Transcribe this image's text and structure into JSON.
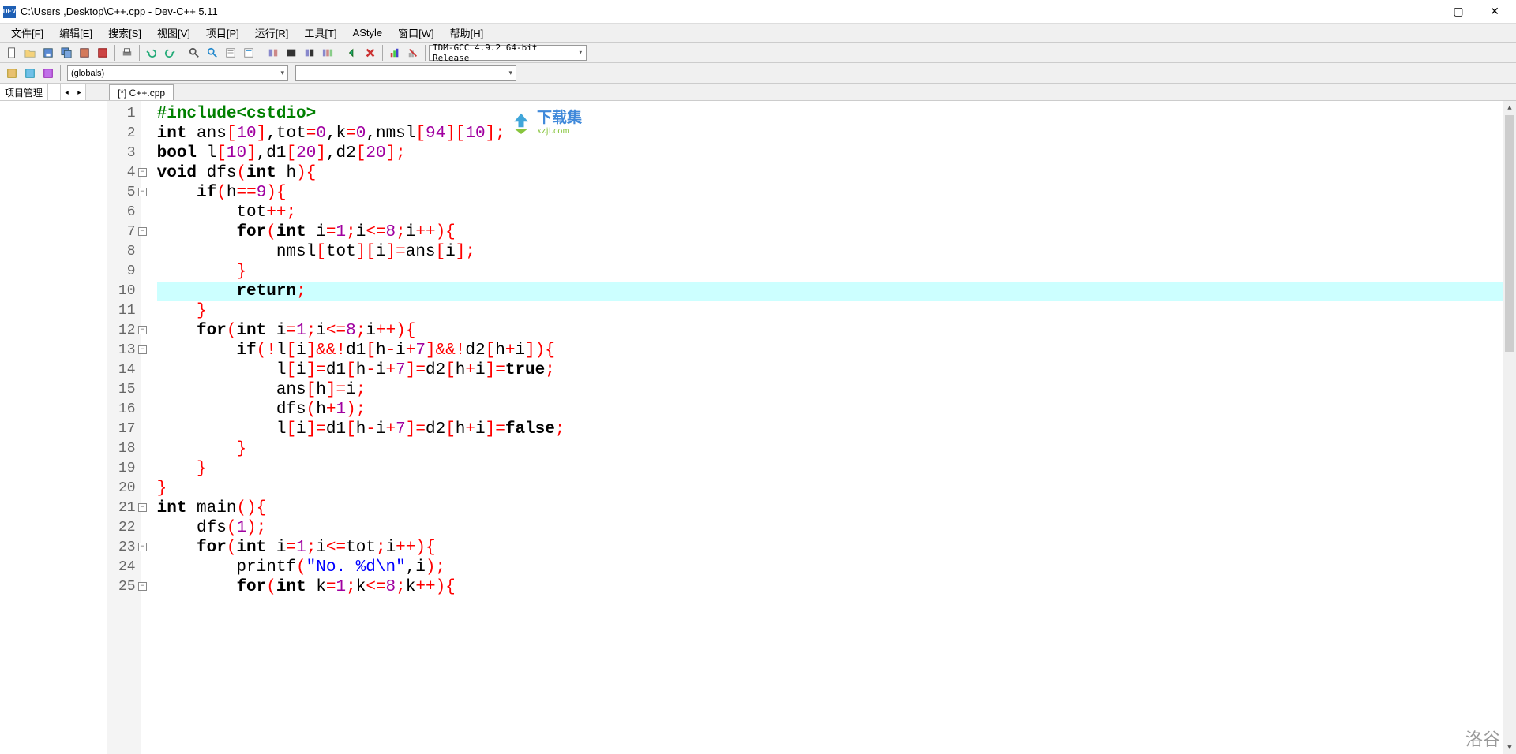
{
  "titlebar": {
    "app_icon_text": "DEV",
    "title": "C:\\Users          ,Desktop\\C++.cpp - Dev-C++ 5.11"
  },
  "menus": [
    "文件[F]",
    "编辑[E]",
    "搜索[S]",
    "视图[V]",
    "项目[P]",
    "运行[R]",
    "工具[T]",
    "AStyle",
    "窗口[W]",
    "帮助[H]"
  ],
  "compiler_combo": "TDM-GCC 4.9.2 64-bit Release",
  "globals_combo": "(globals)",
  "sidebar": {
    "tab_label": "项目管理"
  },
  "file_tab": "[*] C++.cpp",
  "watermark": {
    "cn": "下载集",
    "url": "xzji.com"
  },
  "corner": "洛谷",
  "code": [
    {
      "n": 1,
      "fold": "",
      "tokens": [
        [
          "pp",
          "#include"
        ],
        [
          "pp",
          "<cstdio>"
        ]
      ]
    },
    {
      "n": 2,
      "fold": "",
      "tokens": [
        [
          "k",
          "int "
        ],
        [
          "n",
          "ans"
        ],
        [
          "br",
          "["
        ],
        [
          "num",
          "10"
        ],
        [
          "br",
          "]"
        ],
        [
          "n",
          ",tot"
        ],
        [
          "br",
          "="
        ],
        [
          "num",
          "0"
        ],
        [
          "n",
          ",k"
        ],
        [
          "br",
          "="
        ],
        [
          "num",
          "0"
        ],
        [
          "n",
          ",nmsl"
        ],
        [
          "br",
          "["
        ],
        [
          "num",
          "94"
        ],
        [
          "br",
          "]["
        ],
        [
          "num",
          "10"
        ],
        [
          "br",
          "];"
        ]
      ]
    },
    {
      "n": 3,
      "fold": "",
      "tokens": [
        [
          "k",
          "bool "
        ],
        [
          "n",
          "l"
        ],
        [
          "br",
          "["
        ],
        [
          "num",
          "10"
        ],
        [
          "br",
          "]"
        ],
        [
          "n",
          ",d1"
        ],
        [
          "br",
          "["
        ],
        [
          "num",
          "20"
        ],
        [
          "br",
          "]"
        ],
        [
          "n",
          ",d2"
        ],
        [
          "br",
          "["
        ],
        [
          "num",
          "20"
        ],
        [
          "br",
          "];"
        ]
      ]
    },
    {
      "n": 4,
      "fold": "m",
      "tokens": [
        [
          "k",
          "void "
        ],
        [
          "n",
          "dfs"
        ],
        [
          "br",
          "("
        ],
        [
          "k",
          "int "
        ],
        [
          "n",
          "h"
        ],
        [
          "br",
          "){"
        ]
      ]
    },
    {
      "n": 5,
      "fold": "m",
      "tokens": [
        [
          "n",
          "    "
        ],
        [
          "k",
          "if"
        ],
        [
          "br",
          "("
        ],
        [
          "n",
          "h"
        ],
        [
          "br",
          "=="
        ],
        [
          "num",
          "9"
        ],
        [
          "br",
          "){"
        ]
      ]
    },
    {
      "n": 6,
      "fold": "",
      "tokens": [
        [
          "n",
          "        tot"
        ],
        [
          "br",
          "++;"
        ]
      ]
    },
    {
      "n": 7,
      "fold": "m",
      "tokens": [
        [
          "n",
          "        "
        ],
        [
          "k",
          "for"
        ],
        [
          "br",
          "("
        ],
        [
          "k",
          "int "
        ],
        [
          "n",
          "i"
        ],
        [
          "br",
          "="
        ],
        [
          "num",
          "1"
        ],
        [
          "br",
          ";"
        ],
        [
          "n",
          "i"
        ],
        [
          "br",
          "<="
        ],
        [
          "num",
          "8"
        ],
        [
          "br",
          ";"
        ],
        [
          "n",
          "i"
        ],
        [
          "br",
          "++){"
        ]
      ]
    },
    {
      "n": 8,
      "fold": "",
      "tokens": [
        [
          "n",
          "            nmsl"
        ],
        [
          "br",
          "["
        ],
        [
          "n",
          "tot"
        ],
        [
          "br",
          "]["
        ],
        [
          "n",
          "i"
        ],
        [
          "br",
          "]="
        ],
        [
          "n",
          "ans"
        ],
        [
          "br",
          "["
        ],
        [
          "n",
          "i"
        ],
        [
          "br",
          "];"
        ]
      ]
    },
    {
      "n": 9,
      "fold": "",
      "tokens": [
        [
          "n",
          "        "
        ],
        [
          "br",
          "}"
        ]
      ]
    },
    {
      "n": 10,
      "fold": "",
      "hl": true,
      "tokens": [
        [
          "n",
          "        "
        ],
        [
          "k",
          "return"
        ],
        [
          "br",
          ";"
        ]
      ]
    },
    {
      "n": 11,
      "fold": "",
      "tokens": [
        [
          "n",
          "    "
        ],
        [
          "br",
          "}"
        ]
      ]
    },
    {
      "n": 12,
      "fold": "m",
      "tokens": [
        [
          "n",
          "    "
        ],
        [
          "k",
          "for"
        ],
        [
          "br",
          "("
        ],
        [
          "k",
          "int "
        ],
        [
          "n",
          "i"
        ],
        [
          "br",
          "="
        ],
        [
          "num",
          "1"
        ],
        [
          "br",
          ";"
        ],
        [
          "n",
          "i"
        ],
        [
          "br",
          "<="
        ],
        [
          "num",
          "8"
        ],
        [
          "br",
          ";"
        ],
        [
          "n",
          "i"
        ],
        [
          "br",
          "++){"
        ]
      ]
    },
    {
      "n": 13,
      "fold": "m",
      "tokens": [
        [
          "n",
          "        "
        ],
        [
          "k",
          "if"
        ],
        [
          "br",
          "(!"
        ],
        [
          "n",
          "l"
        ],
        [
          "br",
          "["
        ],
        [
          "n",
          "i"
        ],
        [
          "br",
          "]&&!"
        ],
        [
          "n",
          "d1"
        ],
        [
          "br",
          "["
        ],
        [
          "n",
          "h"
        ],
        [
          "br",
          "-"
        ],
        [
          "n",
          "i"
        ],
        [
          "br",
          "+"
        ],
        [
          "num",
          "7"
        ],
        [
          "br",
          "]&&!"
        ],
        [
          "n",
          "d2"
        ],
        [
          "br",
          "["
        ],
        [
          "n",
          "h"
        ],
        [
          "br",
          "+"
        ],
        [
          "n",
          "i"
        ],
        [
          "br",
          "]){"
        ]
      ]
    },
    {
      "n": 14,
      "fold": "",
      "tokens": [
        [
          "n",
          "            l"
        ],
        [
          "br",
          "["
        ],
        [
          "n",
          "i"
        ],
        [
          "br",
          "]="
        ],
        [
          "n",
          "d1"
        ],
        [
          "br",
          "["
        ],
        [
          "n",
          "h"
        ],
        [
          "br",
          "-"
        ],
        [
          "n",
          "i"
        ],
        [
          "br",
          "+"
        ],
        [
          "num",
          "7"
        ],
        [
          "br",
          "]="
        ],
        [
          "n",
          "d2"
        ],
        [
          "br",
          "["
        ],
        [
          "n",
          "h"
        ],
        [
          "br",
          "+"
        ],
        [
          "n",
          "i"
        ],
        [
          "br",
          "]="
        ],
        [
          "tf",
          "true"
        ],
        [
          "br",
          ";"
        ]
      ]
    },
    {
      "n": 15,
      "fold": "",
      "tokens": [
        [
          "n",
          "            ans"
        ],
        [
          "br",
          "["
        ],
        [
          "n",
          "h"
        ],
        [
          "br",
          "]="
        ],
        [
          "n",
          "i"
        ],
        [
          "br",
          ";"
        ]
      ]
    },
    {
      "n": 16,
      "fold": "",
      "tokens": [
        [
          "n",
          "            dfs"
        ],
        [
          "br",
          "("
        ],
        [
          "n",
          "h"
        ],
        [
          "br",
          "+"
        ],
        [
          "num",
          "1"
        ],
        [
          "br",
          ");"
        ]
      ]
    },
    {
      "n": 17,
      "fold": "",
      "tokens": [
        [
          "n",
          "            l"
        ],
        [
          "br",
          "["
        ],
        [
          "n",
          "i"
        ],
        [
          "br",
          "]="
        ],
        [
          "n",
          "d1"
        ],
        [
          "br",
          "["
        ],
        [
          "n",
          "h"
        ],
        [
          "br",
          "-"
        ],
        [
          "n",
          "i"
        ],
        [
          "br",
          "+"
        ],
        [
          "num",
          "7"
        ],
        [
          "br",
          "]="
        ],
        [
          "n",
          "d2"
        ],
        [
          "br",
          "["
        ],
        [
          "n",
          "h"
        ],
        [
          "br",
          "+"
        ],
        [
          "n",
          "i"
        ],
        [
          "br",
          "]="
        ],
        [
          "tf",
          "false"
        ],
        [
          "br",
          ";"
        ]
      ]
    },
    {
      "n": 18,
      "fold": "",
      "tokens": [
        [
          "n",
          "        "
        ],
        [
          "br",
          "}"
        ]
      ]
    },
    {
      "n": 19,
      "fold": "",
      "tokens": [
        [
          "n",
          "    "
        ],
        [
          "br",
          "}"
        ]
      ]
    },
    {
      "n": 20,
      "fold": "",
      "tokens": [
        [
          "br",
          "}"
        ]
      ]
    },
    {
      "n": 21,
      "fold": "m",
      "tokens": [
        [
          "k",
          "int "
        ],
        [
          "n",
          "main"
        ],
        [
          "br",
          "(){"
        ]
      ]
    },
    {
      "n": 22,
      "fold": "",
      "tokens": [
        [
          "n",
          "    dfs"
        ],
        [
          "br",
          "("
        ],
        [
          "num",
          "1"
        ],
        [
          "br",
          ");"
        ]
      ]
    },
    {
      "n": 23,
      "fold": "m",
      "tokens": [
        [
          "n",
          "    "
        ],
        [
          "k",
          "for"
        ],
        [
          "br",
          "("
        ],
        [
          "k",
          "int "
        ],
        [
          "n",
          "i"
        ],
        [
          "br",
          "="
        ],
        [
          "num",
          "1"
        ],
        [
          "br",
          ";"
        ],
        [
          "n",
          "i"
        ],
        [
          "br",
          "<="
        ],
        [
          "n",
          "tot"
        ],
        [
          "br",
          ";"
        ],
        [
          "n",
          "i"
        ],
        [
          "br",
          "++){"
        ]
      ]
    },
    {
      "n": 24,
      "fold": "",
      "tokens": [
        [
          "n",
          "        printf"
        ],
        [
          "br",
          "("
        ],
        [
          "s",
          "\"No. %d\\n\""
        ],
        [
          "n",
          ",i"
        ],
        [
          "br",
          ");"
        ]
      ]
    },
    {
      "n": 25,
      "fold": "m",
      "tokens": [
        [
          "n",
          "        "
        ],
        [
          "k",
          "for"
        ],
        [
          "br",
          "("
        ],
        [
          "k",
          "int "
        ],
        [
          "n",
          "k"
        ],
        [
          "br",
          "="
        ],
        [
          "num",
          "1"
        ],
        [
          "br",
          ";"
        ],
        [
          "n",
          "k"
        ],
        [
          "br",
          "<="
        ],
        [
          "num",
          "8"
        ],
        [
          "br",
          ";"
        ],
        [
          "n",
          "k"
        ],
        [
          "br",
          "++){"
        ]
      ]
    }
  ]
}
